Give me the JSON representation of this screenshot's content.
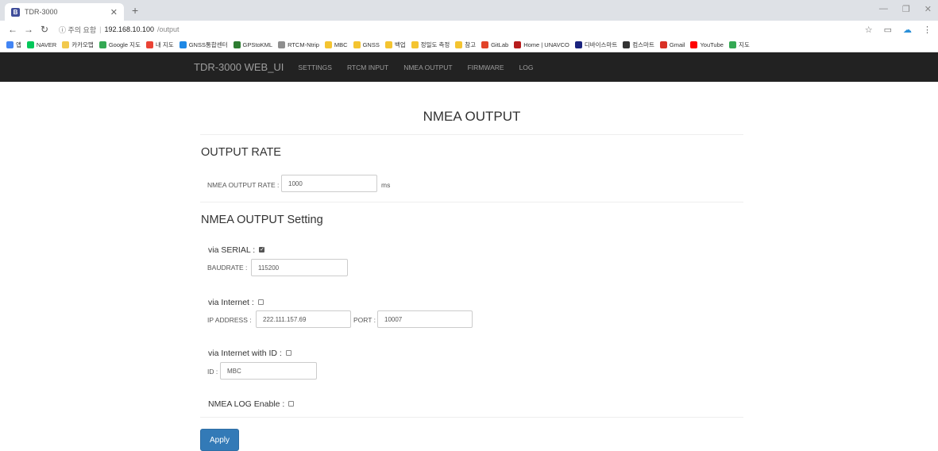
{
  "browser": {
    "tab_title": "TDR-3000",
    "tab_icon_letter": "B",
    "url_warning": "ⓘ 주의 요함",
    "url_host": "192.168.10.100",
    "url_path": "/output",
    "bookmarks": [
      {
        "label": "앱",
        "color": "#4285f4"
      },
      {
        "label": "NAVER",
        "color": "#03c75a"
      },
      {
        "label": "카카오맵",
        "color": "#f2c94c"
      },
      {
        "label": "Google 지도",
        "color": "#34a853"
      },
      {
        "label": "내 지도",
        "color": "#ea4335"
      },
      {
        "label": "GNSS통합센터",
        "color": "#1e88e5"
      },
      {
        "label": "GPStoKML",
        "color": "#2e7d32"
      },
      {
        "label": "RTCM-Ntrip",
        "color": "#8e8e8e"
      },
      {
        "label": "MBC",
        "color": "#f4c430"
      },
      {
        "label": "GNSS",
        "color": "#f4c430"
      },
      {
        "label": "백업",
        "color": "#f4c430"
      },
      {
        "label": "정밀도 측정",
        "color": "#f4c430"
      },
      {
        "label": "참고",
        "color": "#f4c430"
      },
      {
        "label": "GitLab",
        "color": "#e24329"
      },
      {
        "label": "Home | UNAVCO",
        "color": "#b71c1c"
      },
      {
        "label": "디바이스마트",
        "color": "#1a237e"
      },
      {
        "label": "컴스마트",
        "color": "#333333"
      },
      {
        "label": "Gmail",
        "color": "#d93025"
      },
      {
        "label": "YouTube",
        "color": "#ff0000"
      },
      {
        "label": "지도",
        "color": "#34a853"
      }
    ]
  },
  "navbar": {
    "brand": "TDR-3000 WEB_UI",
    "links": [
      "SETTINGS",
      "RTCM INPUT",
      "NMEA OUTPUT",
      "FIRMWARE",
      "LOG"
    ]
  },
  "page": {
    "title": "NMEA OUTPUT",
    "output_rate_heading": "OUTPUT RATE",
    "rate_label": "NMEA OUTPUT RATE :",
    "rate_value": "1000",
    "rate_unit": "ms",
    "setting_heading": "NMEA OUTPUT Setting",
    "serial_label": "via SERIAL :",
    "serial_checked": true,
    "baudrate_label": "BAUDRATE :",
    "baudrate_value": "115200",
    "internet_label": "via Internet :",
    "internet_checked": false,
    "ip_label": "IP ADDRESS :",
    "ip_value": "222.111.157.69",
    "port_label": "PORT :",
    "port_value": "10007",
    "internet_id_label": "via Internet with ID :",
    "internet_id_checked": false,
    "id_label": "ID :",
    "id_value": "MBC",
    "log_label": "NMEA LOG Enable :",
    "log_checked": false,
    "apply_label": "Apply"
  },
  "colors": {
    "navbar_bg": "#222222",
    "primary_button": "#337ab7"
  }
}
